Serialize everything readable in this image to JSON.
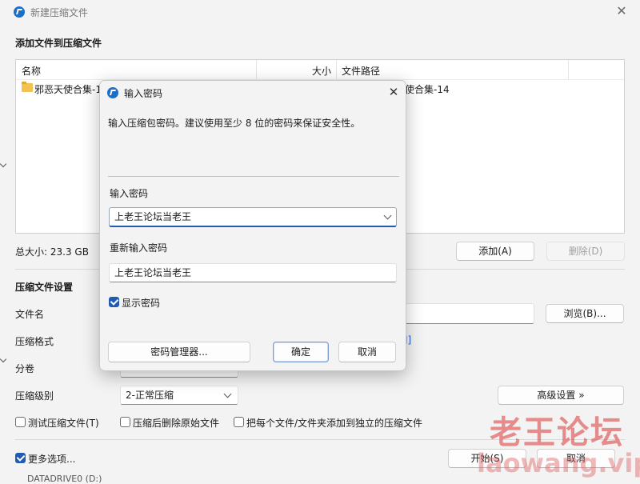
{
  "main": {
    "title": "新建压缩文件",
    "section_add": "添加文件到压缩文件",
    "columns": {
      "name": "名称",
      "size": "大小",
      "path": "文件路径"
    },
    "file_row": {
      "name": "邪恶天使合集-1",
      "path": "使合集-14"
    },
    "total_size": "总大小: 23.3 GB",
    "add_button": "添加(A)",
    "delete_button": "删除(D)",
    "settings_header": "压缩文件设置",
    "filename_label": "文件名",
    "browse_button": "浏览(B)...",
    "format_label": "压缩格式",
    "format_partial": "J]",
    "split_label": "分卷",
    "level_label": "压缩级别",
    "level_value": "2-正常压缩",
    "advanced_button": "高级设置 »",
    "test_checkbox": "测试压缩文件(T)",
    "delete_source_checkbox": "压缩后删除原始文件",
    "each_file_checkbox": "把每个文件/文件夹添加到独立的压缩文件",
    "more_options": "更多选项...",
    "start_button": "开始(S)",
    "cancel_button": "取消",
    "bottom_partial": "DATADRIVE0 (D:)"
  },
  "dialog": {
    "title": "输入密码",
    "description": "输入压缩包密码。建议使用至少 8 位的密码来保证安全性。",
    "password_label": "输入密码",
    "password_value": "上老王论坛当老王",
    "reenter_label": "重新输入密码",
    "reenter_value": "上老王论坛当老王",
    "show_password": "显示密码",
    "manager_button": "密码管理器...",
    "ok_button": "确定",
    "cancel_button": "取消"
  },
  "watermark": {
    "text": "老王论坛",
    "url": "laowang.vip"
  },
  "colors": {
    "accent": "#1f5bb5",
    "watermark": "#e06464"
  }
}
